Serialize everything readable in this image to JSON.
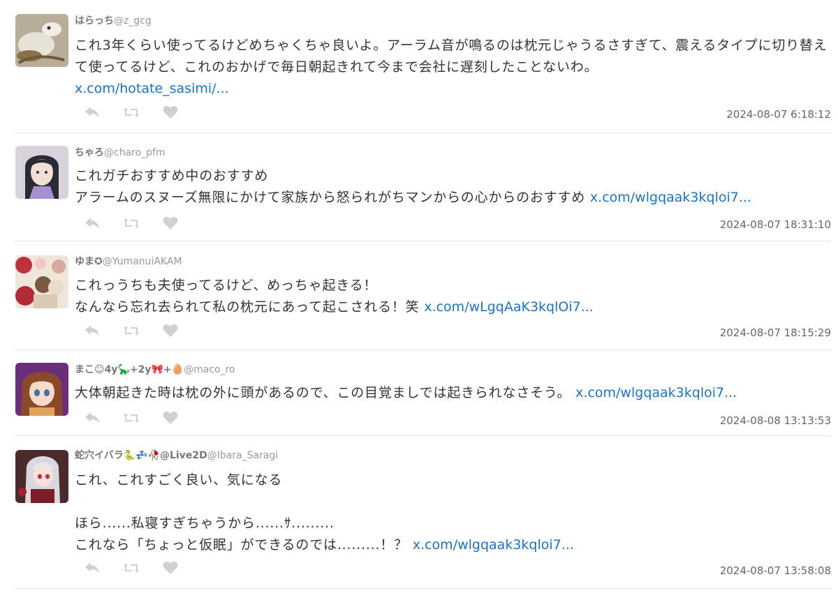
{
  "tweets": [
    {
      "name": "はらっち",
      "handle": "@z_gcg",
      "text": "これ3年くらい使ってるけどめちゃくちゃ良いよ。アーラム音が鳴るのは枕元じゃうるさすぎて、震えるタイプに切り替えて使ってるけど、これのおかげで毎日朝起きれて今まで会社に遅刻したことないわ。",
      "link": "x.com/hotate_sasimi/...",
      "time": "2024-08-07 6:18:12",
      "avatar_color": "#a49a86"
    },
    {
      "name": "ちゃろ",
      "handle": "@charo_pfm",
      "text": "これガチおすすめ中のおすすめ\nアラームのスヌーズ無限にかけて家族から怒られがちマンからの心からのおすすめ ",
      "link": "x.com/wlgqaak3kqloi7...",
      "time": "2024-08-07 18:31:10",
      "avatar_color": "#b9a7cf"
    },
    {
      "name": "ゆま✪",
      "handle": "@YumanuiAKAM",
      "text": "これっうちも夫使ってるけど、めっちゃ起きる！\nなんなら忘れ去られて私の枕元にあって起こされる！笑 ",
      "link": "x.com/wLgqAaK3kqlOi7...",
      "time": "2024-08-07 18:15:29",
      "avatar_color": "#c85a5a"
    },
    {
      "name": "まこ☺4y🦕+2y🎀+🥚",
      "handle": "@maco_ro",
      "text": "大体朝起きた時は枕の外に頭があるので、この目覚ましでは起きられなさそう。 ",
      "link": "x.com/wlgqaak3kqloi7...",
      "time": "2024-08-08 13:13:53",
      "avatar_color": "#7a4a86"
    },
    {
      "name": "蛇穴イバラ🐍💤🥀@Live2D",
      "handle": "@Ibara_Saragi",
      "text": "これ、これすごく良い、気になる\n\nほら......私寝すぎちゃうから......ｻ.........\nこれなら「ちょっと仮眠」ができるのでは.........！？ ",
      "link": "x.com/wlgqaak3kqloi7...",
      "time": "2024-08-07 13:58:08",
      "avatar_color": "#6a3a3a"
    }
  ],
  "icons": {
    "reply": "reply-icon",
    "retweet": "retweet-icon",
    "like": "heart-icon"
  },
  "colors": {
    "link": "#1a73c8",
    "icon": "#d0d0d0",
    "divider": "#e6e6e6"
  }
}
